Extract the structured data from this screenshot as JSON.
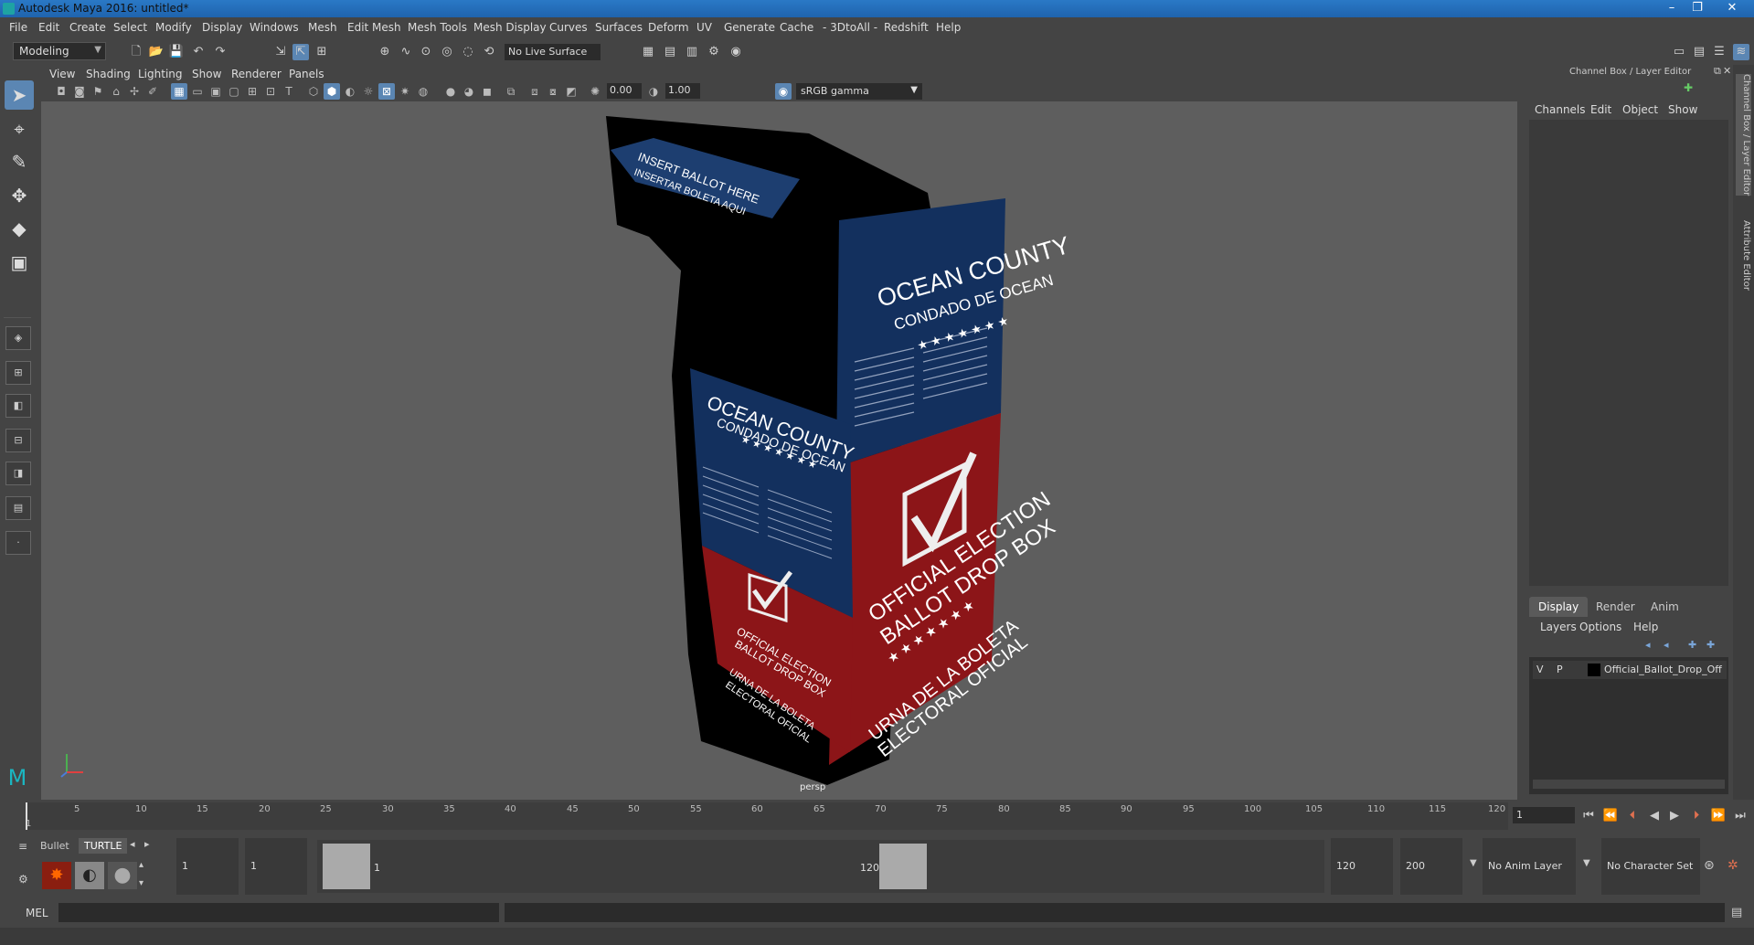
{
  "window": {
    "title": "Autodesk Maya 2016: untitled*"
  },
  "menubar": [
    "File",
    "Edit",
    "Create",
    "Select",
    "Modify",
    "Display",
    "Windows",
    "Mesh",
    "Edit Mesh",
    "Mesh Tools",
    "Mesh Display",
    "Curves",
    "Surfaces",
    "Deform",
    "UV",
    "Generate",
    "Cache",
    "- 3DtoAll -",
    "Redshift",
    "Help"
  ],
  "status": {
    "mode": "Modeling",
    "live_surface": "No Live Surface"
  },
  "panel": {
    "menus": [
      "View",
      "Shading",
      "Lighting",
      "Show",
      "Renderer",
      "Panels"
    ],
    "exposure": "0.00",
    "gamma_value": "1.00",
    "color_space": "sRGB gamma",
    "camera_label": "persp"
  },
  "scene": {
    "box_top_label_1": "INSERT BALLOT HERE",
    "box_top_label_2": "INSERTAR BOLETA AQUI",
    "county": "OCEAN COUNTY",
    "county_es": "CONDADO DE OCEAN",
    "official_1": "OFFICIAL ELECTION",
    "official_2": "BALLOT DROP BOX",
    "urna_1": "URNA DE LA BOLETA",
    "urna_2": "ELECTORAL OFICIAL",
    "stars": "★ ★ ★ ★ ★ ★ ★"
  },
  "channel_box": {
    "title": "Channel Box / Layer Editor",
    "menus": [
      "Channels",
      "Edit",
      "Object",
      "Show"
    ],
    "tabs": [
      "Display",
      "Render",
      "Anim"
    ],
    "layer_menus": [
      "Layers",
      "Options",
      "Help"
    ],
    "layer": {
      "v": "V",
      "p": "P",
      "name": "Official_Ballot_Drop_Off"
    }
  },
  "side_tabs": [
    "Channel Box / Layer Editor",
    "Attribute Editor"
  ],
  "timeline": {
    "ticks": [
      "5",
      "10",
      "15",
      "20",
      "25",
      "30",
      "35",
      "40",
      "45",
      "50",
      "55",
      "60",
      "65",
      "70",
      "75",
      "80",
      "85",
      "90",
      "95",
      "100",
      "105",
      "110",
      "115",
      "120"
    ],
    "first": "1",
    "current_frame": "1"
  },
  "range": {
    "shelf_tabs": [
      "Bullet",
      "TURTLE"
    ],
    "start": "1",
    "playback_start": "1",
    "range_start_label": "1",
    "range_end_label": "120",
    "playback_end": "120",
    "end": "200",
    "anim_layer": "No Anim Layer",
    "character_set": "No Character Set"
  },
  "cmd": {
    "label": "MEL"
  },
  "colors": {
    "accent": "#5b86b3",
    "viewport": "#5e5e5e",
    "box_blue": "#13305e",
    "box_red": "#8c1518"
  }
}
